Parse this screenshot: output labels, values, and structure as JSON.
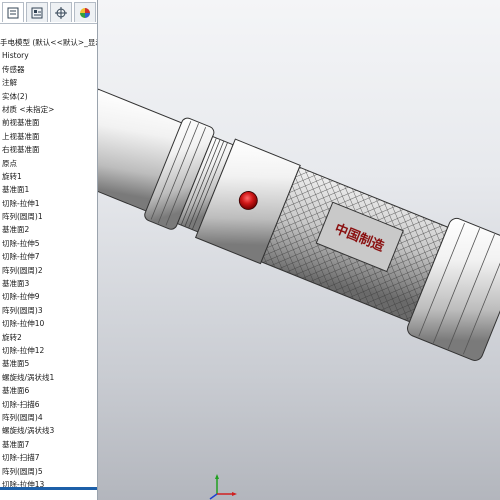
{
  "panel": {
    "tabs": [
      {
        "icon": "feature-manager-icon"
      },
      {
        "icon": "property-manager-icon"
      },
      {
        "icon": "configuration-manager-icon"
      },
      {
        "icon": "appearance-icon"
      }
    ],
    "tree": [
      "手电模型  (默认<<默认>_显示",
      "History",
      "传感器",
      "注解",
      "实体(2)",
      "材质 <未指定>",
      "前视基准面",
      "上视基准面",
      "右视基准面",
      "原点",
      "旋转1",
      "基准面1",
      "切除-拉伸1",
      "阵列(圆周)1",
      "基准面2",
      "切除-拉伸5",
      "切除-拉伸7",
      "阵列(圆周)2",
      "基准面3",
      "切除-拉伸9",
      "阵列(圆周)3",
      "切除-拉伸10",
      "旋转2",
      "切除-拉伸12",
      "基准面5",
      "螺旋线/涡状线1",
      "基准面6",
      "切除-扫描6",
      "阵列(圆周)4",
      "螺旋线/涡状线3",
      "基准面7",
      "切除-扫描7",
      "阵列(圆周)5",
      "切除-拉伸13"
    ]
  },
  "model": {
    "label_text": "中国制造",
    "button_color": "#d01818"
  }
}
